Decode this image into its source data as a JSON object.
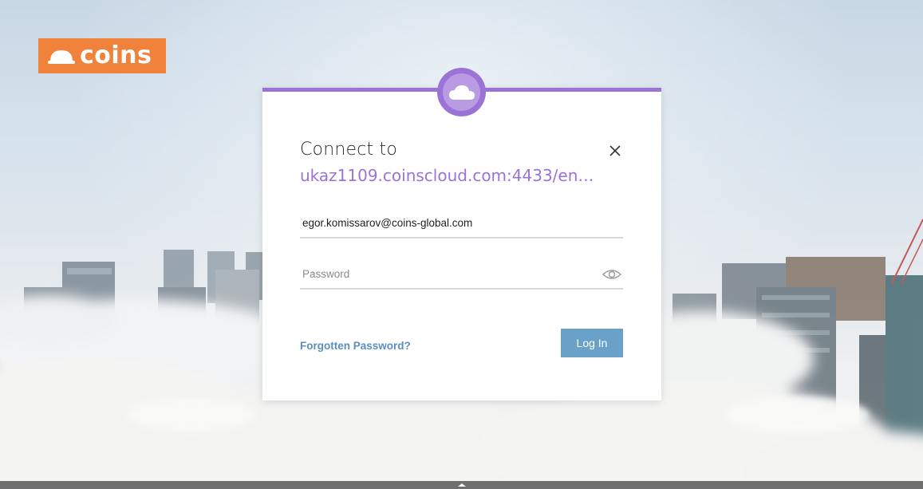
{
  "brand": {
    "logo_text": "coins",
    "logo_color": "#f0823c"
  },
  "dialog": {
    "accent_color": "#9b72d6",
    "badge_icon": "cloud-icon",
    "connect_label": "Connect to",
    "server_url": "ukaz1109.coinscloud.com:4433/en…",
    "close_icon": "close-icon"
  },
  "form": {
    "email_value": "egor.komissarov@coins-global.com",
    "password_placeholder": "Password",
    "password_toggle_icon": "eye-icon",
    "forgot_label": "Forgotten Password?",
    "login_label": "Log In",
    "login_color": "#6aa1c9"
  },
  "bottom_bar": {
    "handle_icon": "chevron-up-icon"
  }
}
